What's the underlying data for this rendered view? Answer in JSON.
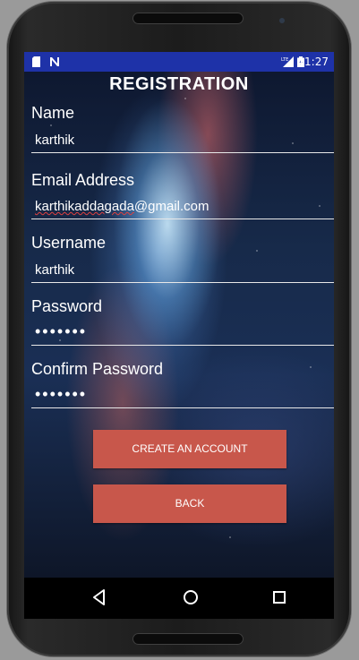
{
  "status_bar": {
    "time": "11:27",
    "background_color": "#1e32a8",
    "left_icons": [
      "sim-card-icon",
      "n-notification-icon"
    ],
    "right_icons": [
      "lte-signal-icon",
      "battery-icon"
    ]
  },
  "form": {
    "title": "REGISTRATION",
    "fields": [
      {
        "label": "Name",
        "value": "karthik",
        "type": "text"
      },
      {
        "label": "Email Address",
        "value": "karthikaddagada@gmail.com",
        "value_underlined": "karthikaddagada",
        "value_rest": "@gmail.com",
        "type": "email"
      },
      {
        "label": "Username",
        "value": "karthik",
        "type": "text"
      },
      {
        "label": "Password",
        "value": "•••••••",
        "type": "password"
      },
      {
        "label": "Confirm Password",
        "value": "•••••••",
        "type": "password"
      }
    ],
    "buttons": {
      "create": "CREATE AN ACCOUNT",
      "back": "BACK",
      "color": "#c8574b"
    }
  },
  "nav_bar": {
    "icons": [
      "back-icon",
      "home-icon",
      "recents-icon"
    ]
  }
}
